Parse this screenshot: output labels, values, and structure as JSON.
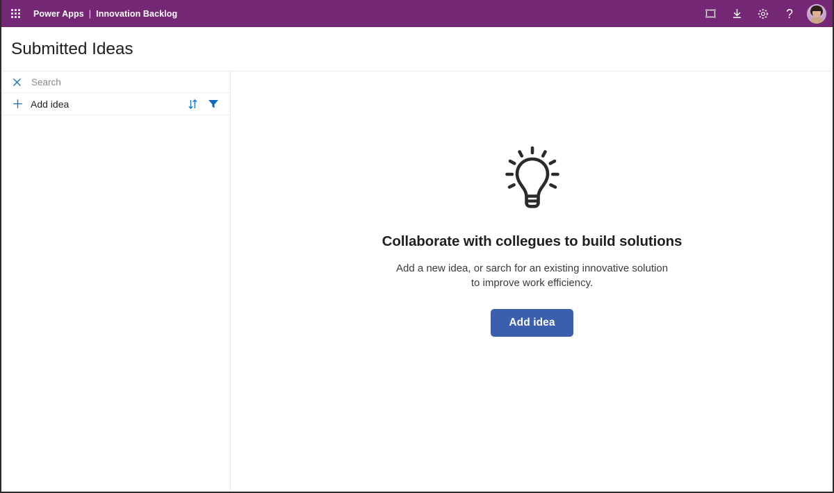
{
  "topbar": {
    "waffle_icon": "app-launcher-waffle-icon",
    "brand": "Power Apps",
    "separator": "|",
    "app_name": "Innovation Backlog",
    "actions": [
      {
        "icon": "fullscreen-frame-icon",
        "label": "Fullscreen"
      },
      {
        "icon": "download-icon",
        "label": "Download"
      },
      {
        "icon": "gear-icon",
        "label": "Settings"
      },
      {
        "icon": "help-question-icon",
        "label": "?"
      }
    ],
    "avatar_label": "User account"
  },
  "page": {
    "title": "Submitted Ideas"
  },
  "sidebar": {
    "search": {
      "icon": "close-x-icon",
      "placeholder": "Search",
      "value": ""
    },
    "add_row": {
      "plus_icon": "plus-icon",
      "label": "Add idea",
      "sort_icon": "sort-arrows-icon",
      "filter_icon": "filter-funnel-icon"
    },
    "items": []
  },
  "main": {
    "illustration_icon": "lightbulb-icon",
    "title": "Collaborate with collegues to build solutions",
    "description": "Add a new idea, or sarch for an existing innovative solution to improve work efficiency.",
    "button_label": "Add idea"
  },
  "colors": {
    "brand_purple": "#742774",
    "accent_blue": "#0f6cbd",
    "button_blue": "#3b5fad",
    "text_primary": "#201f1e",
    "text_secondary": "#8a8886",
    "border": "#e6e6e6"
  }
}
